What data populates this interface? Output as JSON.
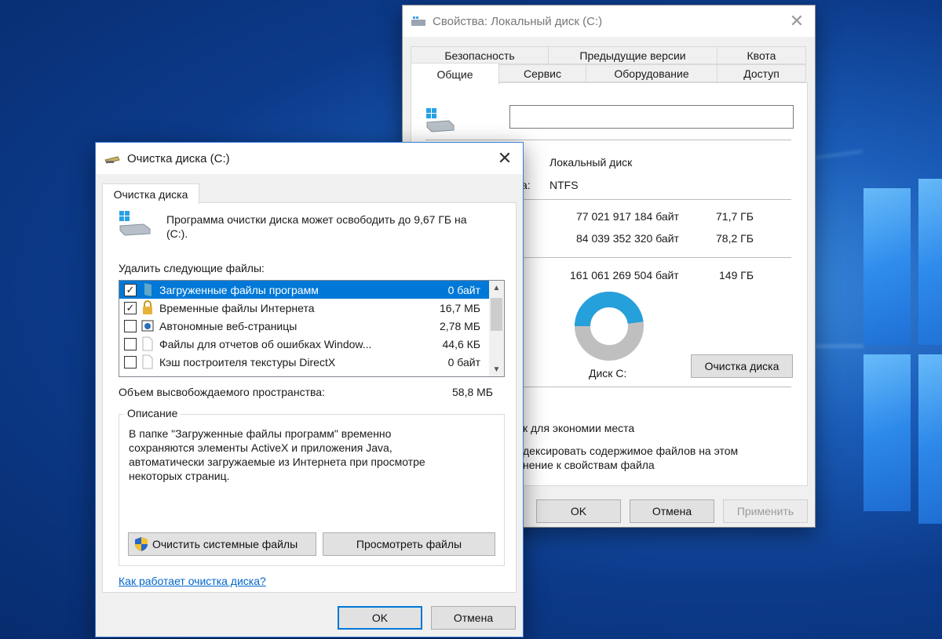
{
  "properties": {
    "title": "Свойства: Локальный диск (C:)",
    "tabs_row1": [
      "Безопасность",
      "Предыдущие версии",
      "Квота"
    ],
    "tabs_row2": [
      "Общие",
      "Сервис",
      "Оборудование",
      "Доступ"
    ],
    "name_value": "",
    "type_value": "Локальный диск",
    "fs_label_fragment": "а:",
    "fs_value": "NTFS",
    "used_bytes": "77 021 917 184 байт",
    "used_gb": "71,7 ГБ",
    "free_bytes": "84 039 352 320 байт",
    "free_gb": "78,2 ГБ",
    "capacity_bytes": "161 061 269 504 байт",
    "capacity_gb": "149 ГБ",
    "disk_label": "Диск C:",
    "cleanup_button": "Очистка диска",
    "compress_fragment": "к для экономии места",
    "index_fragment_1": "дексировать содержимое файлов на этом",
    "index_fragment_2": "нение к свойствам файла",
    "ok": "OK",
    "cancel": "Отмена",
    "apply": "Применить",
    "used_fraction": 0.478,
    "colors": {
      "used": "#26a0da",
      "free": "#bfbfbf"
    }
  },
  "cleanup": {
    "title": "Очистка диска  (C:)",
    "tab": "Очистка диска",
    "intro": "Программа очистки диска может освободить до 9,67 ГБ на",
    "intro_line2": "(C:).",
    "delete_label": "Удалить следующие файлы:",
    "files": [
      {
        "name": "Загруженные файлы программ",
        "size": "0 байт",
        "checked": true,
        "selected": true
      },
      {
        "name": "Временные файлы Интернета",
        "size": "16,7 МБ",
        "checked": true,
        "selected": false
      },
      {
        "name": "Автономные веб-страницы",
        "size": "2,78 МБ",
        "checked": false,
        "selected": false
      },
      {
        "name": "Файлы для отчетов об ошибках Window...",
        "size": "44,6 КБ",
        "checked": false,
        "selected": false
      },
      {
        "name": "Кэш построителя текстуры DirectX",
        "size": "0 байт",
        "checked": false,
        "selected": false
      }
    ],
    "space_label": "Объем высвобождаемого пространства:",
    "space_value": "58,8 МБ",
    "description_label": "Описание",
    "description_lines": [
      "В папке \"Загруженные файлы программ\" временно",
      "сохраняются элементы ActiveX и приложения Java,",
      "автоматически загружаемые из Интернета при просмотре",
      "некоторых страниц."
    ],
    "clean_system_button": "Очистить системные файлы",
    "view_files_button": "Просмотреть файлы",
    "how_link": "Как работает очистка диска?",
    "ok": "OK",
    "cancel": "Отмена"
  }
}
